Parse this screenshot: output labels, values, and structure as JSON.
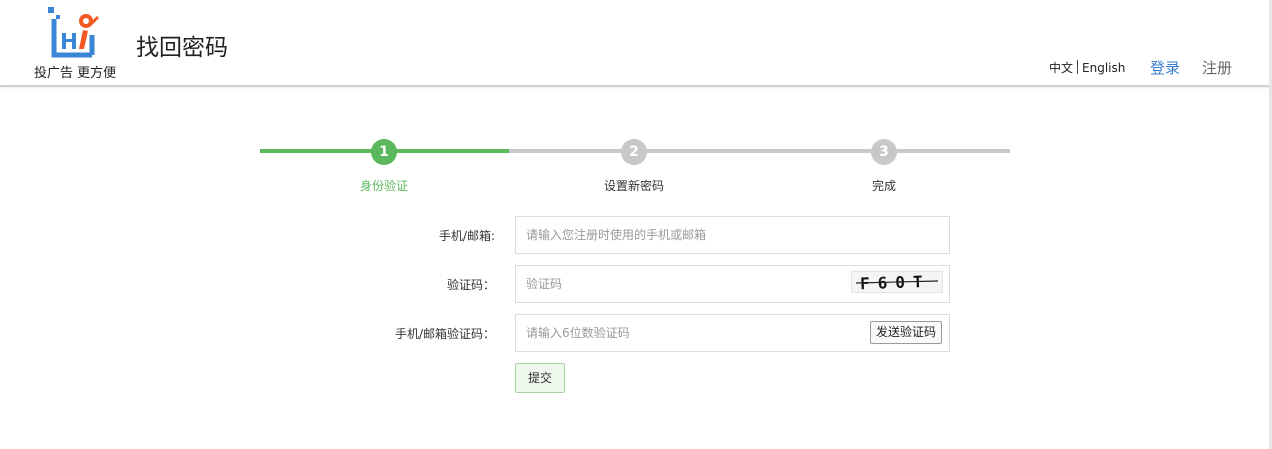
{
  "header": {
    "logo_text": "Hi",
    "tagline": "投广告 更方便",
    "page_title": "找回密码",
    "lang": {
      "zh": "中文",
      "en": "English"
    },
    "login": "登录",
    "register": "注册"
  },
  "steps": [
    {
      "number": "1",
      "label": "身份验证",
      "state": "active"
    },
    {
      "number": "2",
      "label": "设置新密码",
      "state": "pending"
    },
    {
      "number": "3",
      "label": "完成",
      "state": "pending"
    }
  ],
  "colors": {
    "accent_green": "#5cb85c",
    "pending_gray": "#c8c8c8",
    "link_blue": "#3a7fcf",
    "logo_blue": "#3a86d6",
    "logo_orange": "#f25a22"
  },
  "form": {
    "account": {
      "label": "手机/邮箱:",
      "placeholder": "请输入您注册时使用的手机或邮箱"
    },
    "captcha": {
      "label": "验证码：",
      "placeholder": "验证码",
      "image_text": "F60T"
    },
    "code": {
      "label": "手机/邮箱验证码：",
      "placeholder": "请输入6位数验证码",
      "send_button": "发送验证码"
    },
    "submit": "提交"
  }
}
